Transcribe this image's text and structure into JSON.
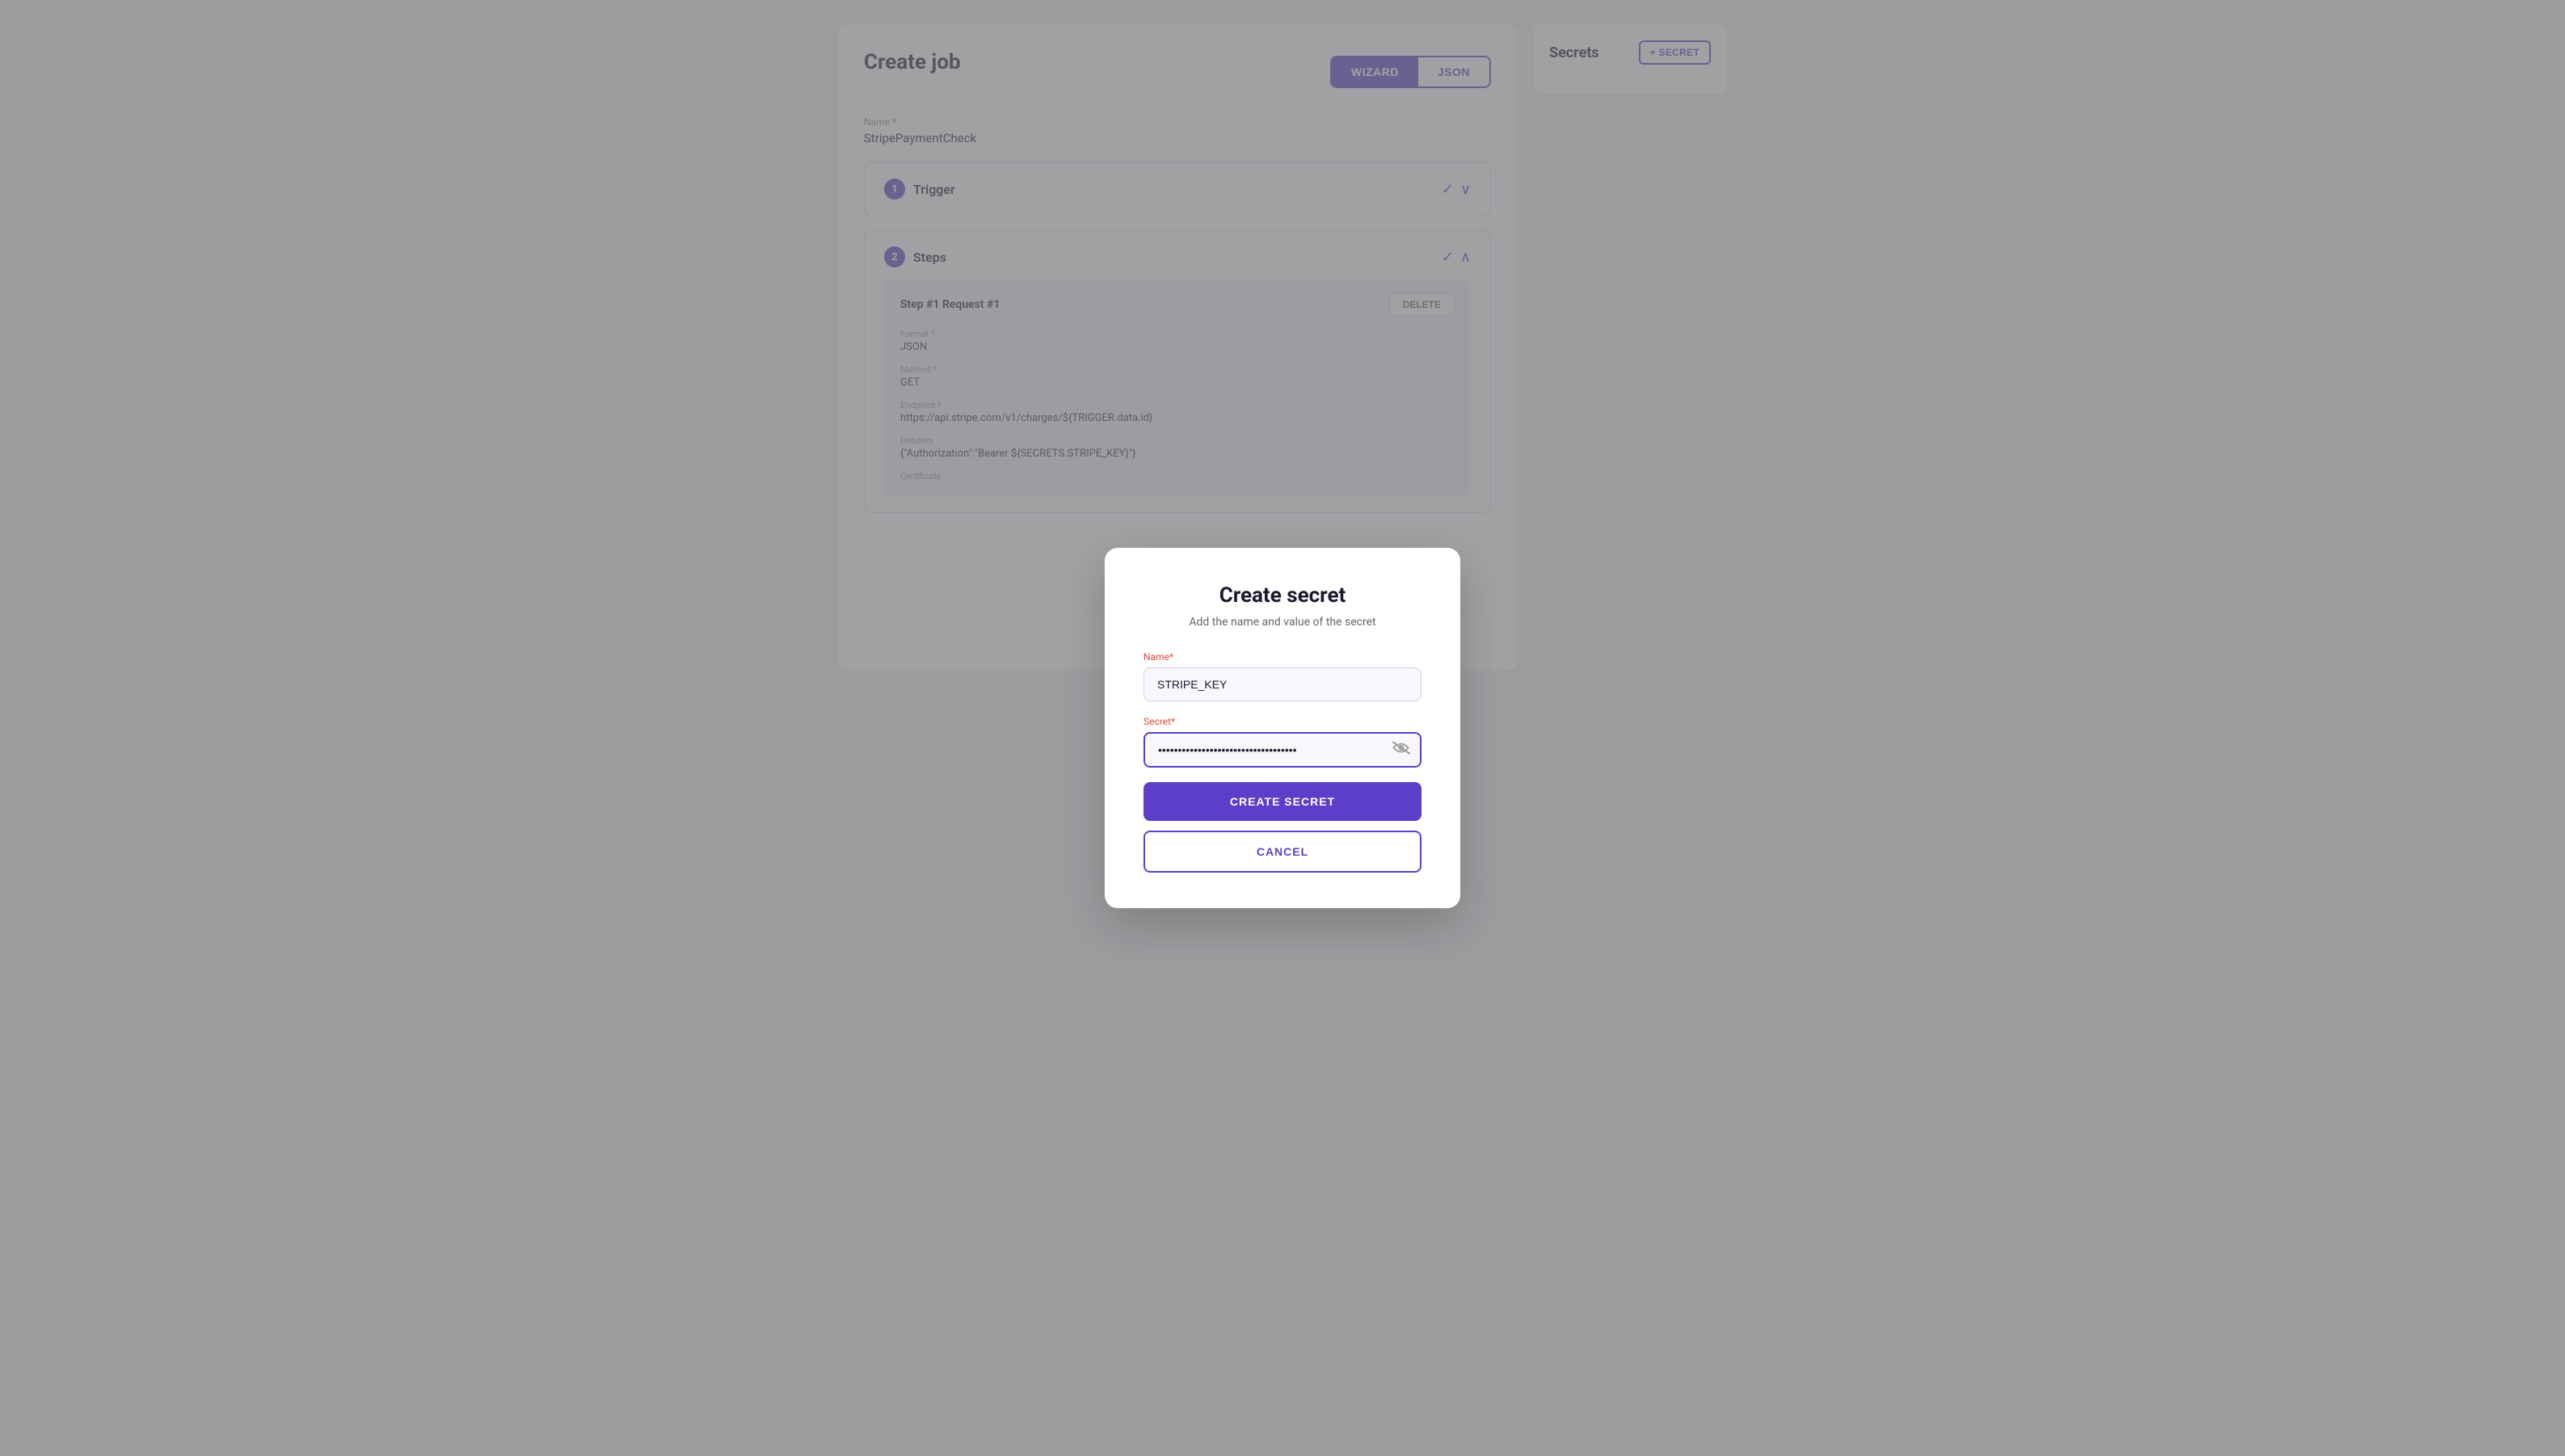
{
  "page": {
    "title": "Create job"
  },
  "tabs": {
    "wizard": "WIZARD",
    "json": "JSON",
    "active": "wizard"
  },
  "form": {
    "name_label": "Name *",
    "name_value": "StripePaymentCheck"
  },
  "sections": [
    {
      "number": "1",
      "title": "Trigger"
    },
    {
      "number": "2",
      "title": "Steps",
      "step": {
        "title": "Step #1  Request #1",
        "delete_label": "DELETE",
        "fields": [
          {
            "label": "Format *",
            "value": "JSON"
          },
          {
            "label": "Method *",
            "value": "GET"
          },
          {
            "label": "Endpoint *",
            "value": "https://api.stripe.com/v1/charges/${TRIGGER.data.id}"
          },
          {
            "label": "Headers",
            "value": "{\"Authorization\":\"Bearer ${SECRETS.STRIPE_KEY}\"}"
          },
          {
            "label": "Certificate",
            "value": ""
          }
        ]
      }
    }
  ],
  "sidebar": {
    "title": "Secrets",
    "add_button": "+ SECRET"
  },
  "modal": {
    "title": "Create secret",
    "subtitle": "Add the name and value of the secret",
    "name_label": "Name",
    "name_required": "*",
    "name_value": "STRIPE_KEY",
    "secret_label": "Secret",
    "secret_required": "*",
    "secret_placeholder": "••••••••••••••••••••••••••••••••••••••",
    "secret_value": "••••••••••••••••••••••••••••••••••••••",
    "create_button": "CREATE SECRET",
    "cancel_button": "CANCEL",
    "eye_icon": "👁"
  }
}
